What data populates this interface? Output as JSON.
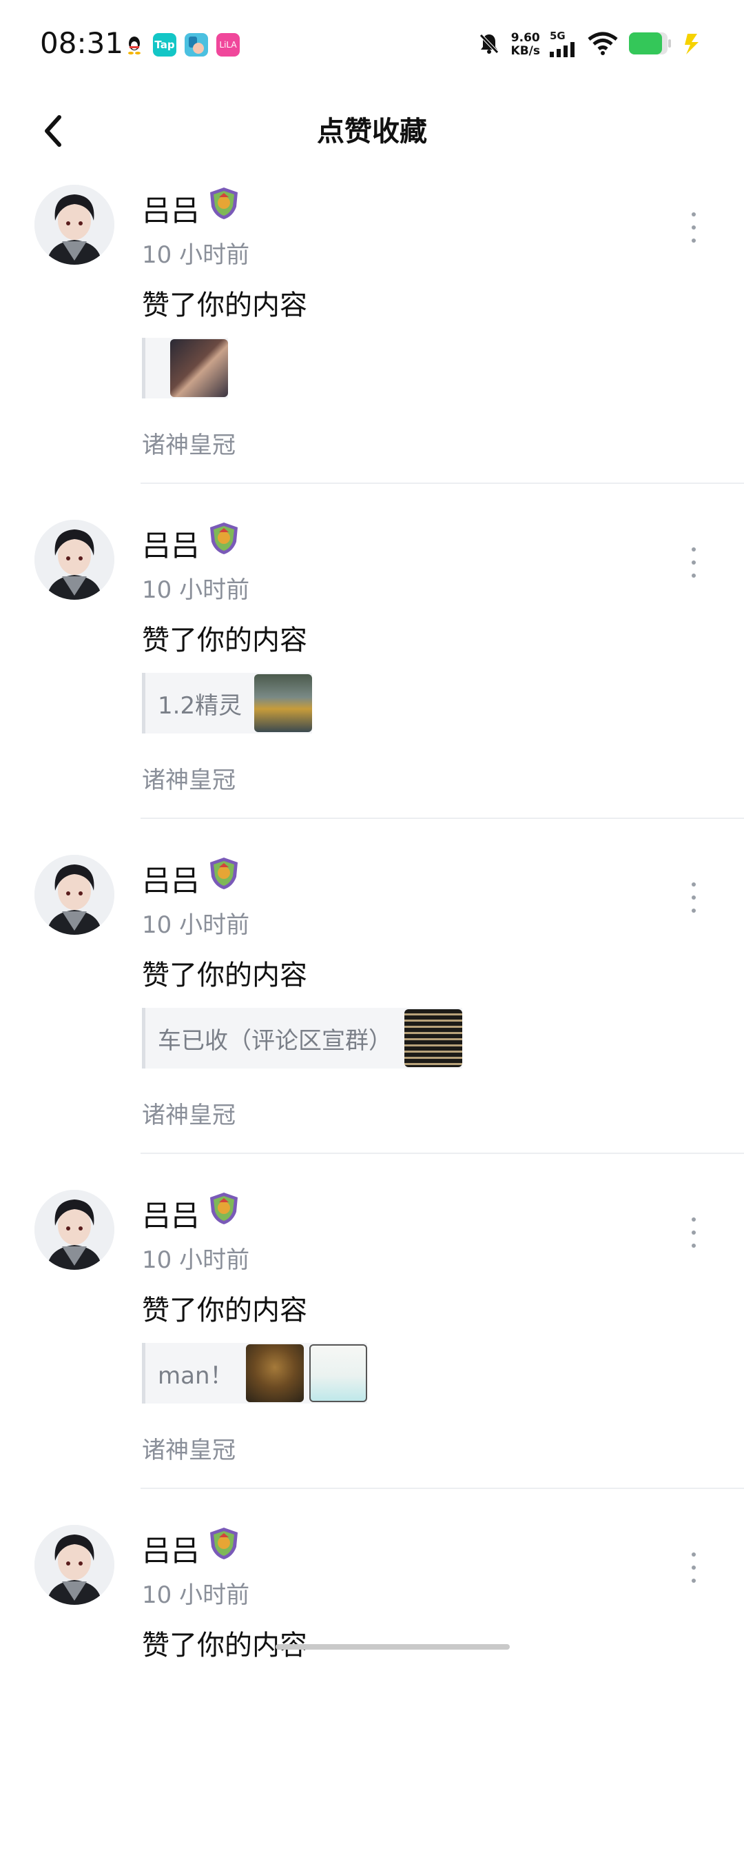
{
  "status_bar": {
    "time": "08:31",
    "tap_label": "Tap",
    "app4_label": "LiLA",
    "speed_value": "9.60",
    "speed_unit": "KB/s",
    "network": "5G",
    "battery_color": "#34c759"
  },
  "header": {
    "title": "点赞收藏",
    "back_icon": "chevron-left-icon"
  },
  "feed": {
    "items": [
      {
        "username": "吕吕",
        "time": "10 小时前",
        "action": "赞了你的内容",
        "quote_text": "",
        "game": "诸神皇冠"
      },
      {
        "username": "吕吕",
        "time": "10 小时前",
        "action": "赞了你的内容",
        "quote_text": "1.2精灵",
        "game": "诸神皇冠"
      },
      {
        "username": "吕吕",
        "time": "10 小时前",
        "action": "赞了你的内容",
        "quote_text": "车已收（评论区宣群）",
        "game": "诸神皇冠"
      },
      {
        "username": "吕吕",
        "time": "10 小时前",
        "action": "赞了你的内容",
        "quote_text": "man！",
        "game": "诸神皇冠"
      },
      {
        "username": "吕吕",
        "time": "10 小时前",
        "action": "赞了你的内容"
      }
    ]
  },
  "colors": {
    "text_primary": "#111111",
    "text_secondary": "#8a8f99",
    "divider": "#eceef1",
    "quote_bg": "#f4f5f7"
  }
}
